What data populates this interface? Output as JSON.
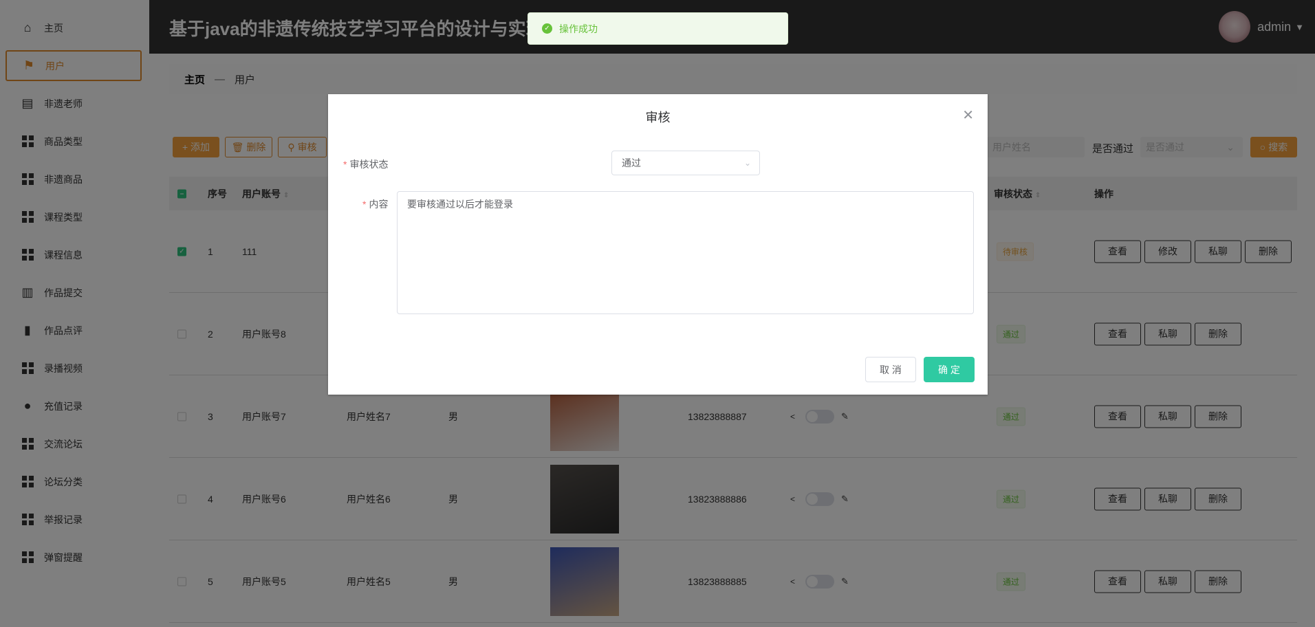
{
  "sidebar": {
    "items": [
      {
        "label": "主页",
        "icon": "home-icon"
      },
      {
        "label": "用户",
        "icon": "flag-icon",
        "active": true
      },
      {
        "label": "非遗老师",
        "icon": "clipboard-icon"
      },
      {
        "label": "商品类型",
        "icon": "grid-icon"
      },
      {
        "label": "非遗商品",
        "icon": "grid-icon"
      },
      {
        "label": "课程类型",
        "icon": "grid-icon"
      },
      {
        "label": "课程信息",
        "icon": "grid-icon"
      },
      {
        "label": "作品提交",
        "icon": "book-icon"
      },
      {
        "label": "作品点评",
        "icon": "bar-chart-icon"
      },
      {
        "label": "录播视频",
        "icon": "grid-icon"
      },
      {
        "label": "充值记录",
        "icon": "person-icon"
      },
      {
        "label": "交流论坛",
        "icon": "grid-icon"
      },
      {
        "label": "论坛分类",
        "icon": "grid-icon"
      },
      {
        "label": "举报记录",
        "icon": "grid-icon"
      },
      {
        "label": "弹窗提醒",
        "icon": "grid-icon"
      }
    ]
  },
  "header": {
    "title": "基于java的非遗传统技艺学习平台的设计与实现",
    "user": "admin"
  },
  "toast": {
    "message": "操作成功"
  },
  "breadcrumb": {
    "home": "主页",
    "sep": "—",
    "current": "用户"
  },
  "toolbar": {
    "add": "+ 添加",
    "delete": "删除",
    "audit": "审核",
    "name_placeholder": "用户姓名",
    "pass_label": "是否通过",
    "pass_placeholder": "是否通过",
    "search": "搜索"
  },
  "table": {
    "headers": {
      "index": "序号",
      "account": "用户账号",
      "status": "审核状态",
      "actions": "操作"
    },
    "rows": [
      {
        "index": "1",
        "account": "111",
        "name": "",
        "gender": "",
        "phone": "",
        "status": "待审核",
        "status_type": "wait",
        "checked": true,
        "actions": [
          "查看",
          "修改",
          "私聊",
          "删除"
        ]
      },
      {
        "index": "2",
        "account": "用户账号8",
        "name": "",
        "gender": "",
        "phone": "",
        "status": "通过",
        "status_type": "pass",
        "checked": false,
        "actions": [
          "查看",
          "私聊",
          "删除"
        ]
      },
      {
        "index": "3",
        "account": "用户账号7",
        "name": "用户姓名7",
        "gender": "男",
        "phone": "13823888887",
        "status": "通过",
        "status_type": "pass",
        "checked": false,
        "photo": [
          "#b0502a",
          "#e8e0dc"
        ],
        "actions": [
          "查看",
          "私聊",
          "删除"
        ]
      },
      {
        "index": "4",
        "account": "用户账号6",
        "name": "用户姓名6",
        "gender": "男",
        "phone": "13823888886",
        "status": "通过",
        "status_type": "pass",
        "checked": false,
        "photo": [
          "#55504c",
          "#2a2a2a"
        ],
        "actions": [
          "查看",
          "私聊",
          "删除"
        ]
      },
      {
        "index": "5",
        "account": "用户账号5",
        "name": "用户姓名5",
        "gender": "男",
        "phone": "13823888885",
        "status": "通过",
        "status_type": "pass",
        "checked": false,
        "photo": [
          "#3e58b8",
          "#c9a884"
        ],
        "actions": [
          "查看",
          "私聊",
          "删除"
        ]
      }
    ]
  },
  "modal": {
    "title": "审核",
    "status_label": "审核状态",
    "status_value": "通过",
    "content_label": "内容",
    "content_value": "要审核通过以后才能登录",
    "cancel": "取 消",
    "confirm": "确 定"
  },
  "colors": {
    "accent": "#e08a2c",
    "confirm": "#2fcaa2",
    "success": "#67c23a"
  }
}
